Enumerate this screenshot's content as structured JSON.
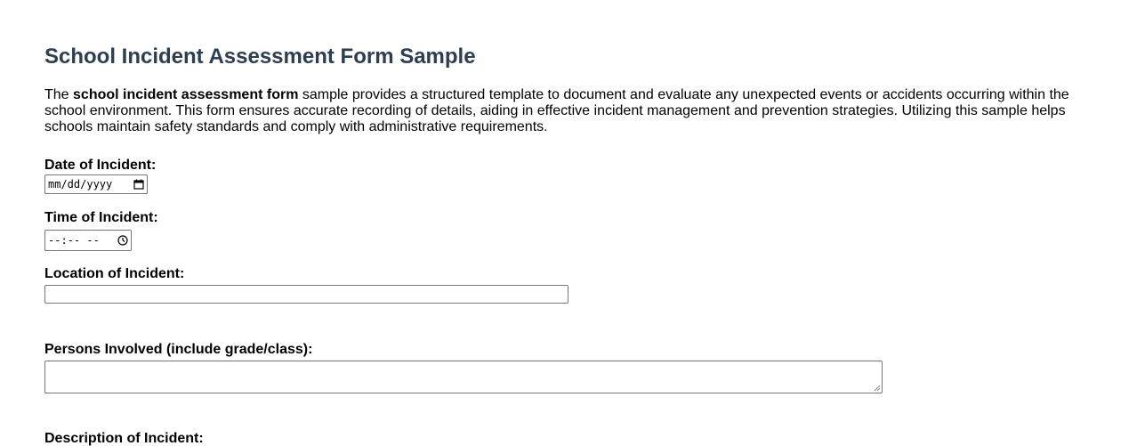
{
  "page": {
    "title": "School Incident Assessment Form Sample",
    "intro": {
      "prefix": "The ",
      "bold": "school incident assessment form",
      "suffix": " sample provides a structured template to document and evaluate any unexpected events or accidents occurring within the school environment. This form ensures accurate recording of details, aiding in effective incident management and prevention strategies. Utilizing this sample helps schools maintain safety standards and comply with administrative requirements."
    }
  },
  "form": {
    "date": {
      "label": "Date of Incident:",
      "mask": "mm/dd/yyyy",
      "icon": "calendar-icon"
    },
    "time": {
      "label": "Time of Incident:",
      "mask": "--:-- --",
      "icon": "clock-icon"
    },
    "location": {
      "label": "Location of Incident:",
      "value": ""
    },
    "persons": {
      "label": "Persons Involved (include grade/class):",
      "value": ""
    },
    "description": {
      "label": "Description of Incident:",
      "value": ""
    }
  },
  "colors": {
    "title": "#2c3e50",
    "input_border": "#767676",
    "text": "#000000",
    "background": "#ffffff"
  }
}
